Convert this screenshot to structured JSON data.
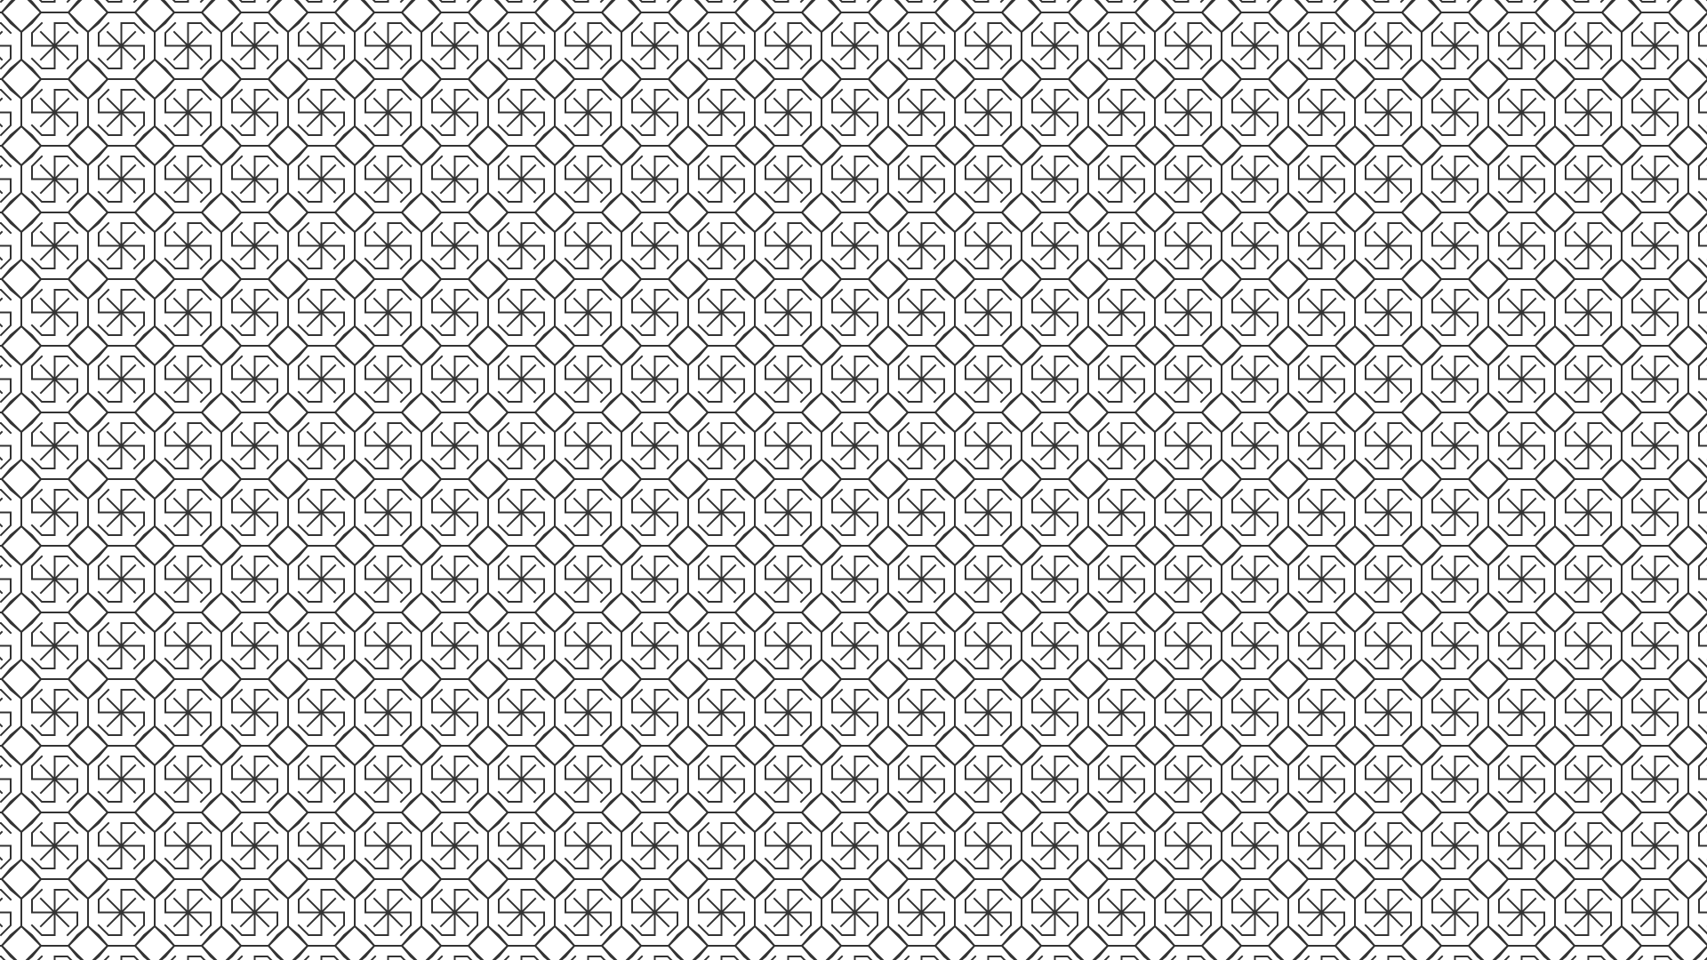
{
  "pattern": {
    "motif": "octagon-pinwheel-star",
    "tiling": "repeating-grid",
    "background_color": "#ffffff",
    "line_color": "#333333",
    "columns_visible": 26,
    "rows_visible": 15
  }
}
